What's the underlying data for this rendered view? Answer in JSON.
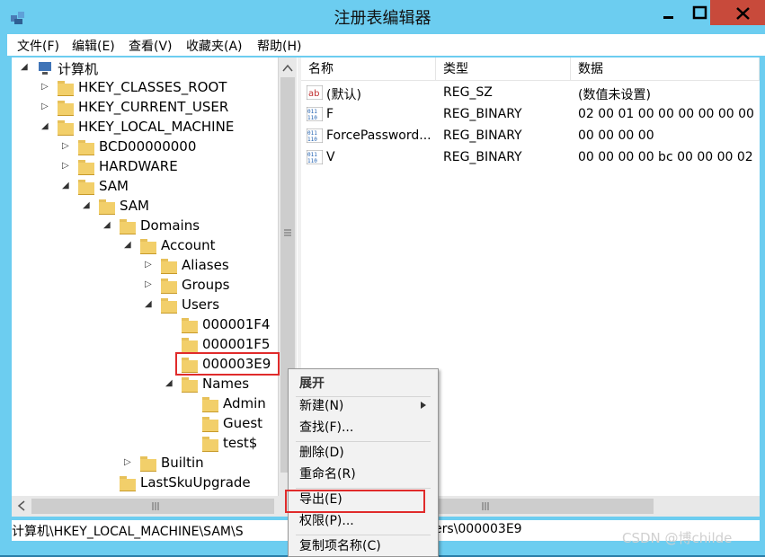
{
  "window": {
    "title": "注册表编辑器"
  },
  "menu": {
    "items": [
      "文件(F)",
      "编辑(E)",
      "查看(V)",
      "收藏夹(A)",
      "帮助(H)"
    ]
  },
  "tree": {
    "nodes": [
      {
        "label": "计算机",
        "depth": 0,
        "expanded": true
      },
      {
        "label": "HKEY_CLASSES_ROOT",
        "depth": 1,
        "expanded": false
      },
      {
        "label": "HKEY_CURRENT_USER",
        "depth": 1,
        "expanded": false
      },
      {
        "label": "HKEY_LOCAL_MACHINE",
        "depth": 1,
        "expanded": true
      },
      {
        "label": "BCD00000000",
        "depth": 2,
        "expanded": false
      },
      {
        "label": "HARDWARE",
        "depth": 2,
        "expanded": false
      },
      {
        "label": "SAM",
        "depth": 2,
        "expanded": true
      },
      {
        "label": "SAM",
        "depth": 3,
        "expanded": true
      },
      {
        "label": "Domains",
        "depth": 4,
        "expanded": true
      },
      {
        "label": "Account",
        "depth": 5,
        "expanded": true
      },
      {
        "label": "Aliases",
        "depth": 6,
        "expanded": false
      },
      {
        "label": "Groups",
        "depth": 6,
        "expanded": false
      },
      {
        "label": "Users",
        "depth": 6,
        "expanded": true
      },
      {
        "label": "000001F4",
        "depth": 7,
        "expanded": null
      },
      {
        "label": "000001F5",
        "depth": 7,
        "expanded": null
      },
      {
        "label": "000003E9",
        "depth": 7,
        "expanded": null,
        "selected": true
      },
      {
        "label": "Names",
        "depth": 7,
        "expanded": true
      },
      {
        "label": "Admin",
        "depth": 8,
        "expanded": null
      },
      {
        "label": "Guest",
        "depth": 8,
        "expanded": null
      },
      {
        "label": "test$",
        "depth": 8,
        "expanded": null
      },
      {
        "label": "Builtin",
        "depth": 5,
        "expanded": false
      },
      {
        "label": "LastSkuUpgrade",
        "depth": 4,
        "expanded": null
      }
    ]
  },
  "list": {
    "columns": [
      "名称",
      "类型",
      "数据"
    ],
    "rows": [
      {
        "name": "(默认)",
        "type": "REG_SZ",
        "data": "(数值未设置)",
        "icon": "string-value-icon"
      },
      {
        "name": "F",
        "type": "REG_BINARY",
        "data": "02 00 01 00 00 00 00 00 00 0",
        "icon": "binary-value-icon"
      },
      {
        "name": "ForcePassword...",
        "type": "REG_BINARY",
        "data": "00 00 00 00",
        "icon": "binary-value-icon"
      },
      {
        "name": "V",
        "type": "REG_BINARY",
        "data": "00 00 00 00 bc 00 00 00 02 0",
        "icon": "binary-value-icon"
      }
    ]
  },
  "context_menu": {
    "header": "展开",
    "items": [
      "新建(N)",
      "查找(F)...",
      "删除(D)",
      "重命名(R)",
      "导出(E)",
      "权限(P)...",
      "复制项名称(C)"
    ]
  },
  "status": {
    "left": "计算机\\HKEY_LOCAL_MACHINE\\SAM\\S",
    "right": "ers\\000003E9"
  },
  "watermark": "CSDN @博childe",
  "colors": {
    "title_bar": "#6ccdf0",
    "close": "#c84a3b",
    "highlight_box": "#e02b2b"
  }
}
